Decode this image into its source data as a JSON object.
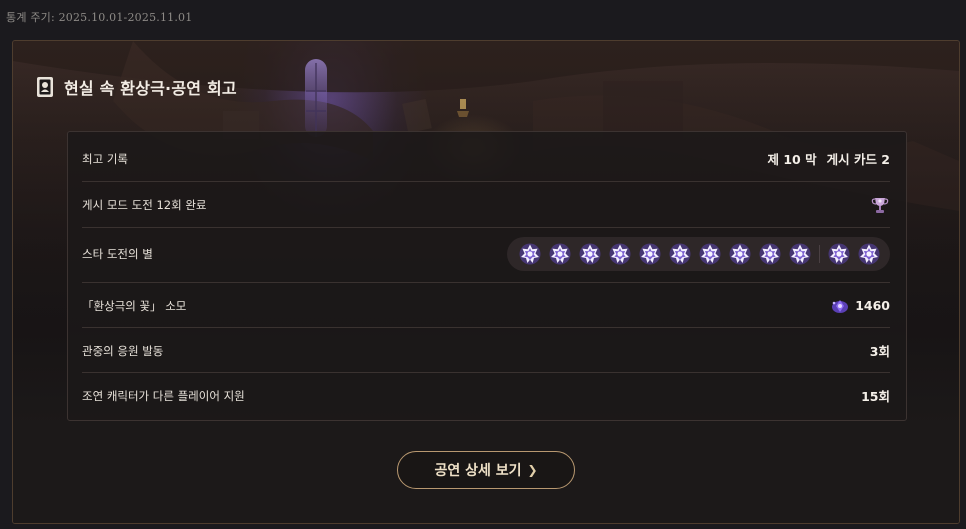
{
  "header": {
    "stat_period": "통계 주기: 2025.10.01-2025.11.01"
  },
  "section": {
    "title": "현실 속 환상극·공연 회고",
    "icon": "theater-card-icon"
  },
  "stats": {
    "best_record": {
      "label": "최고 기록",
      "act": "제 10 막",
      "card": "게시 카드 2"
    },
    "hidden_mode": {
      "label": "게시 모드 도전 12회 완료",
      "icon": "trophy-icon"
    },
    "star_challenge": {
      "label": "스타 도전의 별",
      "count": 12,
      "icon": "star-badge-icon"
    },
    "flower_spent": {
      "label": "「환상극의 꽃」 소모",
      "value": "1460",
      "icon": "flower-gem-icon"
    },
    "audience_support": {
      "label": "관중의 응원 발동",
      "value": "3회"
    },
    "support_characters": {
      "label": "조연 캐릭터가 다른 플레이어 지원",
      "value": "15회"
    }
  },
  "actions": {
    "detail_button": "공연 상세 보기"
  },
  "colors": {
    "background": "#1b1a1e",
    "panel_border": "#4e3d2e",
    "accent_gold": "#b89870",
    "star_purple": "#7b5fd0",
    "text": "#f2ece4"
  }
}
